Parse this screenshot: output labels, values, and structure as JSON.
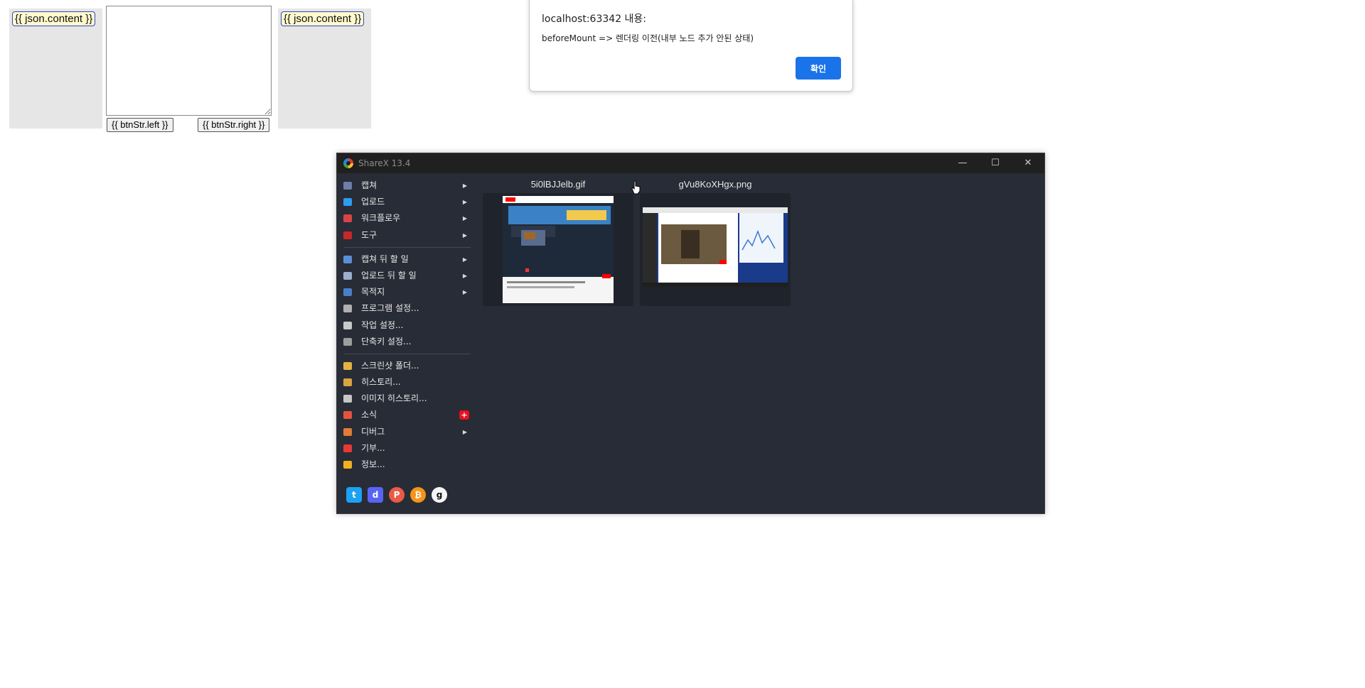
{
  "page": {
    "left_content": "{{ json.content }}",
    "right_content": "{{ json.content }}",
    "btn_left": "{{ btnStr.left }}",
    "btn_right": "{{ btnStr.right }}"
  },
  "dialog": {
    "title": "localhost:63342 내용:",
    "message": "beforeMount => 렌더링 이전(내부 노드 추가 안된 상태)",
    "ok_label": "확인"
  },
  "sharex": {
    "title": "ShareX 13.4",
    "menu": [
      {
        "label": "캡쳐",
        "icon": "capture-icon",
        "color": "#6b7fa8",
        "submenu": true
      },
      {
        "label": "업로드",
        "icon": "upload-arrow-icon",
        "color": "#2e9cf0",
        "submenu": true
      },
      {
        "label": "워크플로우",
        "icon": "workflow-grid-icon",
        "color": "#d64545",
        "submenu": true
      },
      {
        "label": "도구",
        "icon": "tools-icon",
        "color": "#c62828",
        "submenu": true
      },
      {
        "label": "캡쳐 뒤 할 일",
        "icon": "after-capture-icon",
        "color": "#5a8fd6",
        "submenu": true,
        "sep_before": true
      },
      {
        "label": "업로드 뒤 할 일",
        "icon": "cloud-icon",
        "color": "#9ab0cc",
        "submenu": true
      },
      {
        "label": "목적지",
        "icon": "destination-icon",
        "color": "#4a7fc8",
        "submenu": true
      },
      {
        "label": "프로그램 설정...",
        "icon": "wrench-icon",
        "color": "#b0b0b0",
        "submenu": false
      },
      {
        "label": "작업 설정...",
        "icon": "gear-icon",
        "color": "#c9c9c9",
        "submenu": false
      },
      {
        "label": "단축키 설정...",
        "icon": "keyboard-icon",
        "color": "#9e9e9e",
        "submenu": false
      },
      {
        "label": "스크린샷 폴더...",
        "icon": "folder-icon",
        "color": "#e3b341",
        "submenu": false,
        "sep_before": true
      },
      {
        "label": "히스토리...",
        "icon": "history-icon",
        "color": "#d9a441",
        "submenu": false
      },
      {
        "label": "이미지 히스토리...",
        "icon": "image-history-icon",
        "color": "#c6c6c6",
        "submenu": false
      },
      {
        "label": "소식",
        "icon": "megaphone-icon",
        "color": "#e5533d",
        "submenu": false,
        "badge": "+"
      },
      {
        "label": "디버그",
        "icon": "debug-icon",
        "color": "#e07b39",
        "submenu": true
      },
      {
        "label": "기부...",
        "icon": "heart-icon",
        "color": "#e53935",
        "submenu": false
      },
      {
        "label": "정보...",
        "icon": "crown-icon",
        "color": "#f2b01e",
        "submenu": false
      }
    ],
    "social": [
      {
        "name": "twitter-icon",
        "glyph": "t",
        "color": "#1da1f2"
      },
      {
        "name": "discord-icon",
        "glyph": "d",
        "color": "#5865f2"
      },
      {
        "name": "patreon-icon",
        "glyph": "P",
        "color": "#e85b46"
      },
      {
        "name": "bitcoin-icon",
        "glyph": "₿",
        "color": "#f7931a"
      },
      {
        "name": "github-icon",
        "glyph": "g",
        "color": "#f5f5f5"
      }
    ],
    "thumbnails": [
      {
        "filename": "5i0lBJJelb.gif"
      },
      {
        "filename": "gVu8KoXHgx.png"
      }
    ]
  }
}
